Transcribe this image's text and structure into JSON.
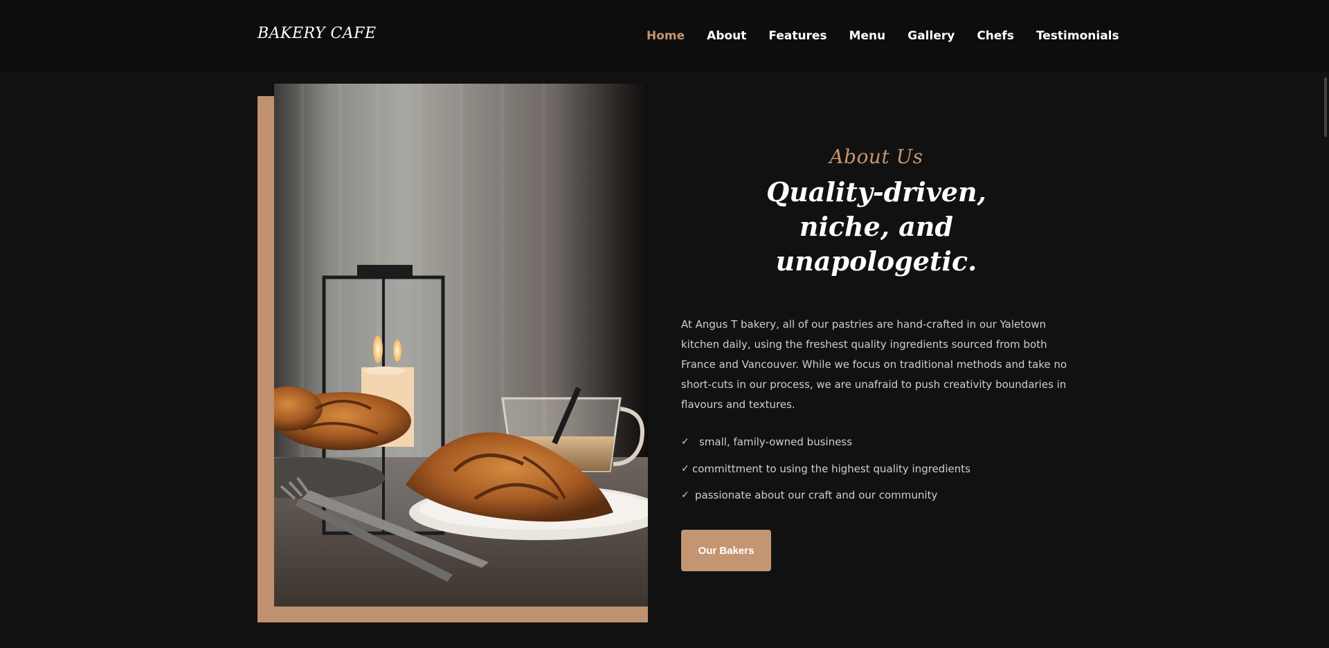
{
  "header": {
    "brand": "BAKERY CAFE",
    "nav": [
      {
        "label": "Home",
        "active": true
      },
      {
        "label": "About",
        "active": false
      },
      {
        "label": "Features",
        "active": false
      },
      {
        "label": "Menu",
        "active": false
      },
      {
        "label": "Gallery",
        "active": false
      },
      {
        "label": "Chefs",
        "active": false
      },
      {
        "label": "Testimonials",
        "active": false
      }
    ]
  },
  "about": {
    "eyebrow": "About Us",
    "headline": "Quality-driven, niche, and unapologetic.",
    "body": "At Angus T bakery, all of our pastries are hand-crafted in our Yaletown kitchen daily, using the freshest quality ingredients sourced from both France and Vancouver. While we focus on traditional methods and take no short-cuts in our process, we are unafraid to push creativity boundaries in flavours and textures.",
    "features": [
      "small, family-owned business",
      "committment to using the highest quality ingredients",
      "passionate about our craft and our community"
    ],
    "cta_label": "Our Bakers"
  },
  "colors": {
    "accent": "#c49573",
    "background": "#111111",
    "header_bg": "#0d0d0d",
    "text": "#cfcfcf"
  },
  "icons": {
    "check": "checkmark-icon"
  }
}
